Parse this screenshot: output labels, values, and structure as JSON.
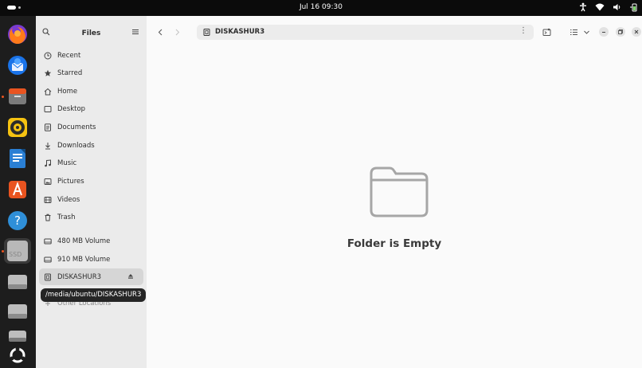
{
  "topbar": {
    "clock": "Jul 16  09:30",
    "tray_icons": [
      "accessibility-icon",
      "wifi-icon",
      "volume-icon",
      "battery-icon"
    ]
  },
  "dock": {
    "apps": [
      "firefox-icon",
      "thunderbird-icon",
      "files-icon",
      "rhythmbox-icon",
      "libreoffice-writer-icon",
      "app-center-icon",
      "help-icon",
      "ssd-drive-icon",
      "drive-icon",
      "drive-icon",
      "usb-drive-icon",
      "show-apps-icon"
    ],
    "ssd_label": "SSD"
  },
  "sidebar": {
    "title": "Files",
    "items": [
      {
        "label": "Recent",
        "icon": "clock-icon"
      },
      {
        "label": "Starred",
        "icon": "star-icon"
      },
      {
        "label": "Home",
        "icon": "home-icon"
      },
      {
        "label": "Desktop",
        "icon": "desktop-icon"
      },
      {
        "label": "Documents",
        "icon": "document-icon"
      },
      {
        "label": "Downloads",
        "icon": "download-icon"
      },
      {
        "label": "Music",
        "icon": "music-icon"
      },
      {
        "label": "Pictures",
        "icon": "picture-icon"
      },
      {
        "label": "Videos",
        "icon": "video-icon"
      },
      {
        "label": "Trash",
        "icon": "trash-icon"
      }
    ],
    "devices": [
      {
        "label": "480 MB Volume",
        "icon": "drive-icon"
      },
      {
        "label": "910 MB Volume",
        "icon": "drive-icon"
      },
      {
        "label": "DISKASHUR3",
        "icon": "usb-icon"
      }
    ],
    "other_locations": "Other Locations"
  },
  "tooltip": "/media/ubuntu/DISKASHUR3",
  "main": {
    "path_label": "DISKASHUR3",
    "empty_title": "Folder is Empty"
  },
  "colors": {
    "accent": "#e95420",
    "sidebar_bg": "#ebebeb",
    "main_bg": "#fafafa",
    "topbar_bg": "#0b0b0b",
    "dock_bg": "#1d1d1d"
  }
}
